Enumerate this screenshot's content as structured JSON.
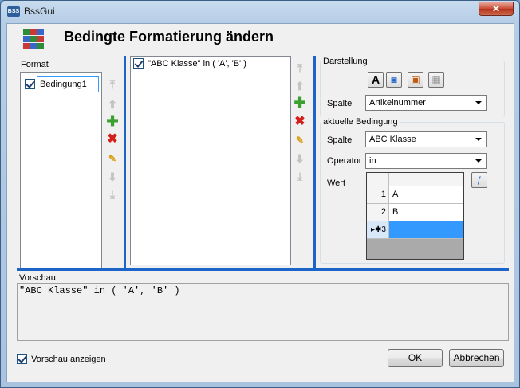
{
  "window": {
    "title": "BssGui",
    "app_icon": "bss-app-icon",
    "close_label": "✕"
  },
  "header": {
    "title": "Bedingte Formatierung ändern",
    "icon": "conditional-format-icon"
  },
  "format": {
    "label": "Format",
    "items": [
      {
        "label": "Bedingung1",
        "checked": true
      }
    ]
  },
  "conditions": {
    "items": [
      {
        "label": "\"ABC Klasse\" in ( 'A', 'B' )",
        "checked": true
      }
    ]
  },
  "toolbar_icons": [
    "move-top-icon",
    "move-up-icon",
    "add-icon",
    "delete-icon",
    "clear-icon",
    "move-down-icon",
    "move-bottom-icon"
  ],
  "darstellung": {
    "label": "Darstellung",
    "buttons": [
      "font-icon",
      "fill-color-icon",
      "font-color-icon",
      "border-icon"
    ],
    "spalte_label": "Spalte",
    "spalte_value": "Artikelnummer"
  },
  "aktuelle_bedingung": {
    "label": "aktuelle Bedingung",
    "spalte_label": "Spalte",
    "spalte_value": "ABC Klasse",
    "operator_label": "Operator",
    "operator_value": "in",
    "wert_label": "Wert",
    "wert_rows": [
      {
        "num": "1",
        "value": "A"
      },
      {
        "num": "2",
        "value": "B"
      },
      {
        "num": "▸✱3",
        "value": ""
      }
    ]
  },
  "vorschau": {
    "label": "Vorschau",
    "text": "\"ABC Klasse\" in ( 'A', 'B' )"
  },
  "footer": {
    "show_preview_label": "Vorschau anzeigen",
    "show_preview_checked": true,
    "ok_label": "OK",
    "cancel_label": "Abbrechen"
  },
  "colors": {
    "accent": "#1c64c8",
    "selection": "#3399ff"
  }
}
